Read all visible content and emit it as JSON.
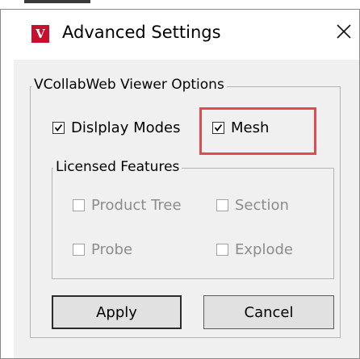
{
  "window": {
    "title": "Advanced Settings",
    "app_icon_letter": "V",
    "accent": "#c8102e"
  },
  "viewer_options": {
    "legend": "VCollabWeb Viewer Options",
    "display_modes": {
      "label": "Dislplay Modes",
      "checked": true
    },
    "mesh": {
      "label": "Mesh",
      "checked": true
    }
  },
  "licensed_features": {
    "legend": "Licensed Features",
    "items": [
      {
        "label": "Product Tree",
        "checked": false,
        "enabled": false
      },
      {
        "label": "Section",
        "checked": false,
        "enabled": false
      },
      {
        "label": "Probe",
        "checked": false,
        "enabled": false
      },
      {
        "label": "Explode",
        "checked": false,
        "enabled": false
      }
    ]
  },
  "buttons": {
    "apply": "Apply",
    "cancel": "Cancel"
  },
  "highlight_color": "#e5484d",
  "icons": {
    "close": "close-icon",
    "check": "checkmark-icon"
  }
}
